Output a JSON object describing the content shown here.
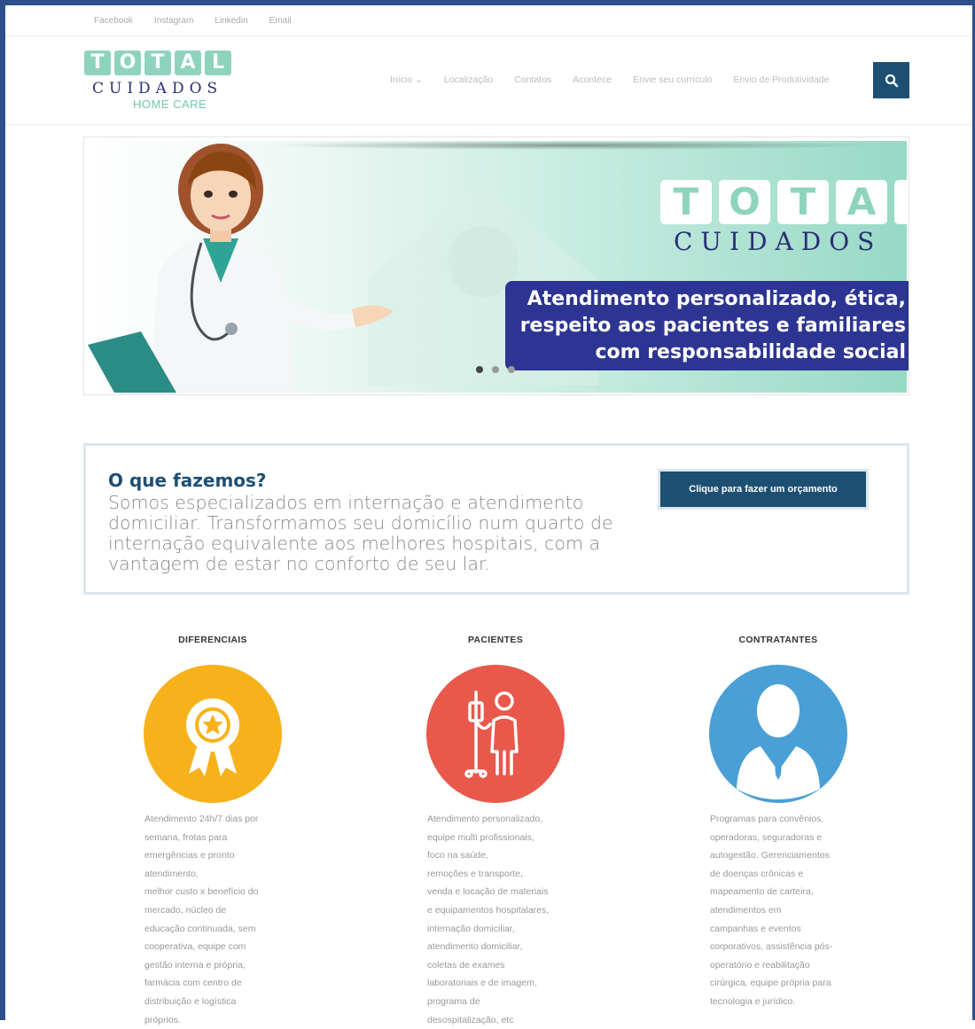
{
  "top_links": [
    "Facebook",
    "Instagram",
    "Linkedin",
    "Email"
  ],
  "logo": {
    "letters": [
      "T",
      "O",
      "T",
      "A",
      "L"
    ],
    "cuidados": "CUIDADOS",
    "home_care": "HOME CARE"
  },
  "nav": {
    "inicio": "Início ⌄",
    "localizacao": "Localização",
    "contatos": "Contatos",
    "acontece": "Acontece",
    "curriculo": "Envie seu currículo",
    "produtividade": "Envio de Produtividade"
  },
  "slider": {
    "letters": [
      "T",
      "O",
      "T",
      "A",
      "L"
    ],
    "cuidados": "CUIDADOS",
    "line1": "Atendimento personalizado, ética,",
    "line2": "respeito aos pacientes e familiares",
    "line3": "com responsabilidade social"
  },
  "cta": {
    "title": "O que fazemos?",
    "text": "Somos especializados em internação e atendimento domiciliar. Transformamos seu domicílio num quarto de internação equivalente aos melhores hospitais, com a vantagem de estar no conforto de seu lar.",
    "button": "Clique para fazer um orçamento"
  },
  "columns": [
    {
      "title": "DIFERENCIAIS",
      "color": "#f7b21b",
      "icon": "award-badge-icon",
      "lines": [
        "Atendimento 24h/7 dias por",
        "semana, frotas para",
        "emergências e pronto",
        "atendimento,",
        "melhor custo x benefício do",
        "mercado, núcleo de",
        "educação continuada, sem",
        "cooperativa, equipe com",
        "gestão interna e própria,",
        "farmácia com centro de",
        "distribuição e logística",
        "próprios."
      ]
    },
    {
      "title": "PACIENTES",
      "color": "#e8584b",
      "icon": "patient-iv-icon",
      "lines": [
        "Atendimento personalizado,",
        "equipe multi profissionais,",
        "foco na saúde,",
        "remoções e transporte,",
        "venda e locação de materiais",
        "e equipamentos hospitalares,",
        "internação domiciliar,",
        "atendimento domiciliar,",
        "coletas de exames",
        "laboratoriais e de imagem,",
        "programa de",
        "desospitalização, etc"
      ]
    },
    {
      "title": "CONTRATANTES",
      "color": "#4a9fd6",
      "icon": "businessman-icon",
      "lines": [
        "Programas para convênios,",
        "operadoras, seguradoras e",
        "autogestão. Gerenciamentos",
        "de doenças crônicas e",
        "mapeamento de carteira,",
        "atendimentos em",
        "campanhas e eventos",
        "corporativos, assistência pós-",
        "operatório e reabilitação",
        "cirúrgica, equipe própria para",
        "tecnologia e jurídico."
      ]
    }
  ]
}
